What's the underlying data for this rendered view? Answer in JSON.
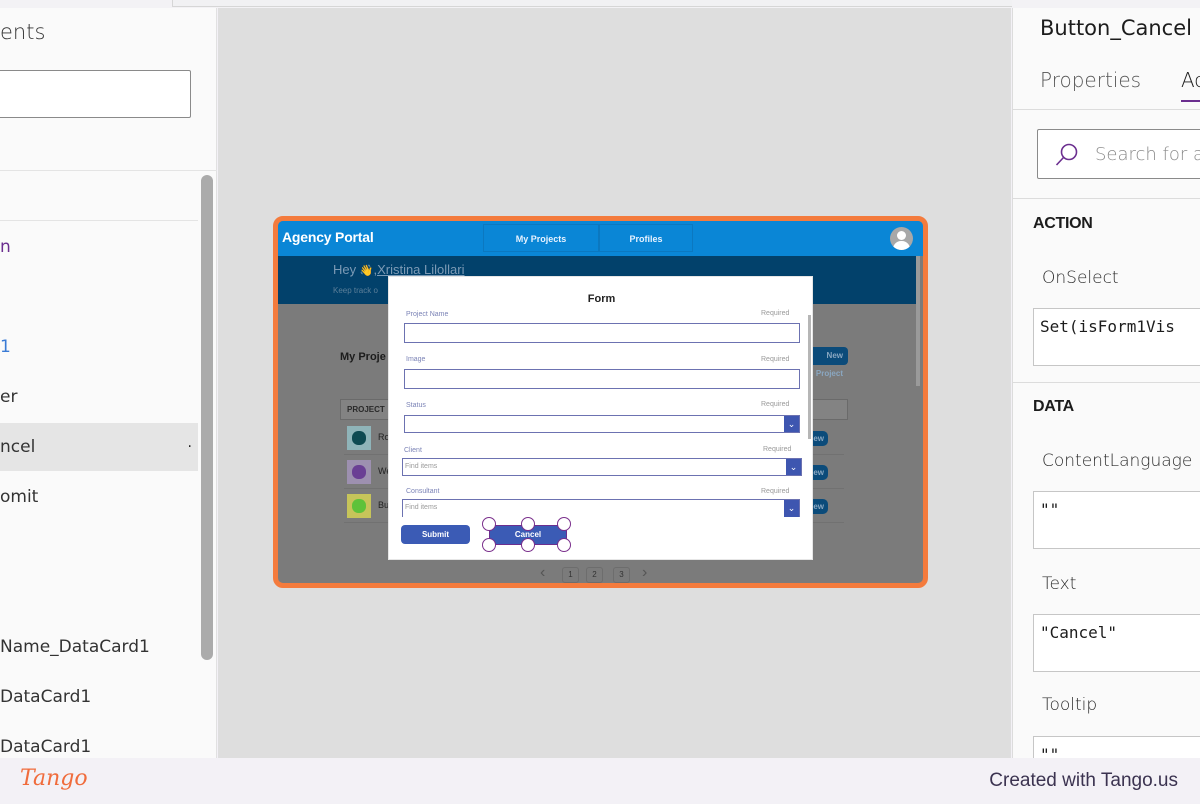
{
  "left_panel": {
    "title": "ents",
    "search_value": "",
    "items": [
      {
        "label": "n",
        "style": "accent"
      },
      {
        "label": ""
      },
      {
        "label": "1",
        "style": "blue"
      },
      {
        "label": "er"
      },
      {
        "label": "ncel",
        "selected": true,
        "more": "·"
      },
      {
        "label": "omit"
      },
      {
        "label": ""
      },
      {
        "label": ""
      },
      {
        "label": " Name_DataCard1"
      },
      {
        "label": "DataCard1"
      },
      {
        "label": "DataCard1"
      }
    ]
  },
  "app": {
    "title": "Agency Portal",
    "nav_tabs": [
      "My Projects",
      "Profiles"
    ],
    "avatar_icon": "user-avatar-icon",
    "greeting_prefix": "Hey",
    "greeting_emoji": "👋",
    "greeting_name": ",Xristina Lilollari",
    "subtitle": "Keep track o",
    "section_title": "My Proje",
    "new_project_label": "New Project",
    "table": {
      "header": "PROJECT",
      "rows": [
        {
          "name": "Ro",
          "thumb_color": "#0e4a52",
          "thumb_bg": "#8fb4b9",
          "action": "View"
        },
        {
          "name": "We",
          "thumb_color": "#6a3f94",
          "thumb_bg": "#9d90b0",
          "action": "View"
        },
        {
          "name": "Bu",
          "thumb_color": "#5ec23a",
          "thumb_bg": "#c6c45a",
          "action": "View"
        }
      ]
    },
    "pager": {
      "prev": "‹",
      "next": "›",
      "pages": [
        "1",
        "2",
        "3"
      ]
    }
  },
  "form": {
    "title": "Form",
    "fields": [
      {
        "label": "Project Name",
        "required": "Required",
        "type": "text",
        "value": ""
      },
      {
        "label": "Image",
        "required": "Required",
        "type": "text",
        "value": ""
      },
      {
        "label": "Status",
        "required": "Required",
        "type": "dropdown",
        "value": ""
      },
      {
        "label": "Client",
        "required": "Required",
        "type": "combobox",
        "placeholder": "Find items"
      },
      {
        "label": "Consultant",
        "required": "Required",
        "type": "combobox",
        "placeholder": "Find items"
      }
    ],
    "submit_label": "Submit",
    "cancel_label": "Cancel",
    "dropdown_glyph": "⌄"
  },
  "right_panel": {
    "control_name": "Button_Cancel",
    "tabs": [
      "Properties",
      "Advanced"
    ],
    "visible_tab_text": [
      "Properties",
      "Ac"
    ],
    "active_tab": "Advanced",
    "search_placeholder": "Search for a",
    "sections": [
      {
        "title": "ACTION",
        "props": [
          {
            "name": "OnSelect",
            "value": "Set(isForm1Vis"
          }
        ]
      },
      {
        "title": "DATA",
        "props": [
          {
            "name": "ContentLanguage",
            "value": "\"\""
          },
          {
            "name": "Text",
            "value": "\"Cancel\""
          },
          {
            "name": "Tooltip",
            "value": "\"\""
          }
        ]
      }
    ]
  },
  "footer": {
    "logo": "Tango",
    "credit": "Created with Tango.us"
  },
  "colors": {
    "highlight_border": "#f47b3d",
    "app_header": "#0a86d6",
    "app_hero": "#02416b",
    "form_button": "#3b5bb5",
    "selection_accent": "#6b2e8f"
  }
}
